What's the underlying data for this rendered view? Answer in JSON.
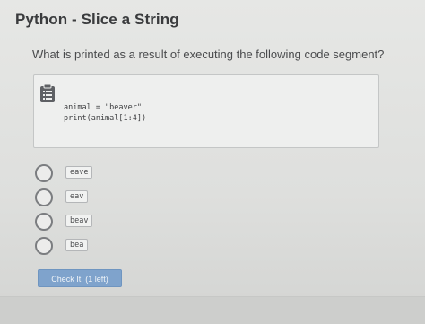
{
  "header": {
    "title": "Python - Slice a String"
  },
  "question": {
    "prompt": "What is printed as a result of executing the following code segment?"
  },
  "code": {
    "icon": "clipboard-icon",
    "lines": [
      "animal = \"beaver\"",
      "print(animal[1:4])"
    ]
  },
  "options": [
    {
      "label": "eave"
    },
    {
      "label": "eav"
    },
    {
      "label": "beav"
    },
    {
      "label": "bea"
    }
  ],
  "actions": {
    "check_label": "Check It! (1 left)"
  },
  "colors": {
    "accent": "#7fa3cc",
    "background": "#e2e3e1"
  }
}
